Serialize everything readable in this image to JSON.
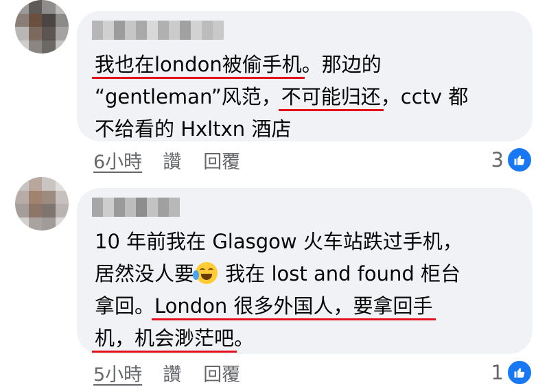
{
  "comments": [
    {
      "lines": [
        [
          {
            "t": "我也在london被偷手机",
            "u": true
          },
          {
            "t": "。那边的",
            "u": false
          }
        ],
        [
          {
            "t": "“gentleman”风范，",
            "u": false
          },
          {
            "t": "不可能归还",
            "u": true
          },
          {
            "t": "，cctv 都",
            "u": false
          }
        ],
        [
          {
            "t": "不给看的 Hxltxn 酒店",
            "u": false
          }
        ]
      ],
      "time": "6小時",
      "like_label": "讚",
      "reply_label": "回覆",
      "reaction_count": "3"
    },
    {
      "lines": [
        [
          {
            "t": "10 年前我在 Glasgow 火车站跌过手机，",
            "u": false
          }
        ],
        [
          {
            "t": "居然没人要",
            "u": false
          },
          {
            "emoji": "face-with-tears-of-joy"
          },
          {
            "t": " 我在 lost and found 柜台",
            "u": false
          }
        ],
        [
          {
            "t": "拿回。",
            "u": false
          },
          {
            "t": "London 很多外国人，要拿回手",
            "u": true
          }
        ],
        [
          {
            "t": "机，机会渺茫吧",
            "u": true
          },
          {
            "t": "。",
            "u": false
          }
        ]
      ],
      "time": "5小時",
      "like_label": "讚",
      "reply_label": "回覆",
      "reaction_count": "1"
    }
  ],
  "colors": {
    "bubble": "#f0f2f5",
    "underline": "#e3101b",
    "secondary_text": "#65676b",
    "like_blue": "#1877f2"
  },
  "icons": {
    "reaction": "thumbs-up-icon",
    "emoji": "face-with-tears-of-joy"
  }
}
